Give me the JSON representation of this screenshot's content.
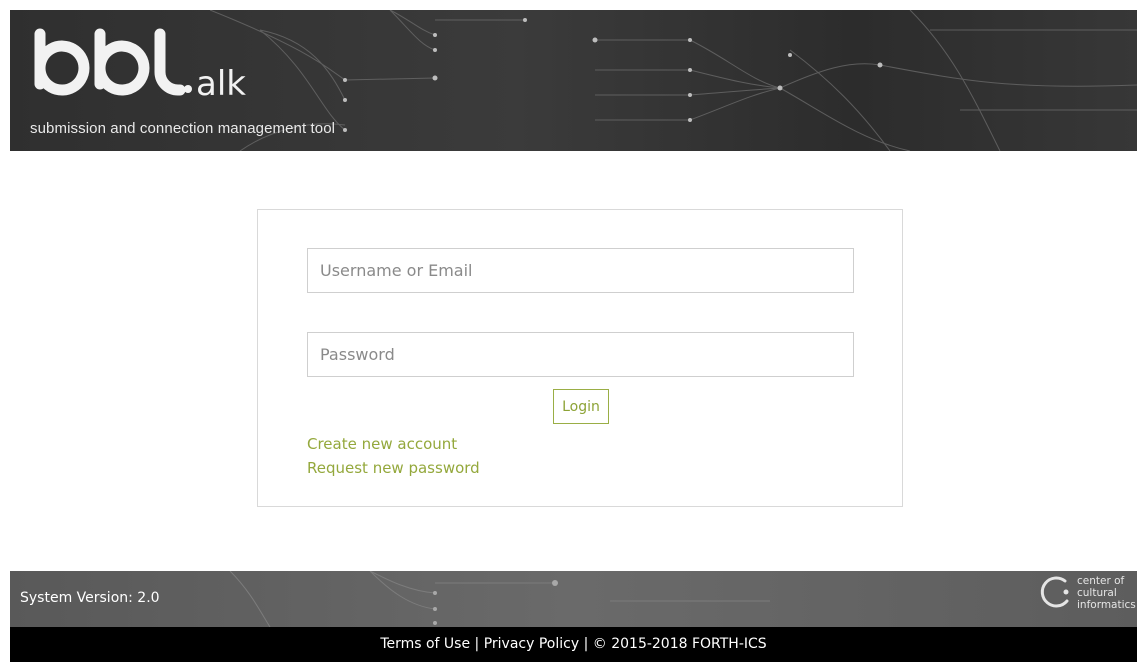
{
  "header": {
    "logo_text": "bbtalk",
    "subtitle": "submission and connection management tool"
  },
  "login": {
    "username_placeholder": "Username or Email",
    "password_placeholder": "Password",
    "login_label": "Login",
    "create_account_label": "Create new account",
    "request_password_label": "Request new password"
  },
  "footer": {
    "system_version": "System Version: 2.0",
    "logo_text": "center of cultural informatics",
    "terms_label": "Terms of Use",
    "privacy_label": "Privacy Policy",
    "separator": "|",
    "copyright": "© 2015-2018 FORTH-ICS"
  },
  "colors": {
    "accent": "#94a83c",
    "header_bg": "#333333",
    "footer_bg": "#636363",
    "bottom_bar_bg": "#000000"
  }
}
